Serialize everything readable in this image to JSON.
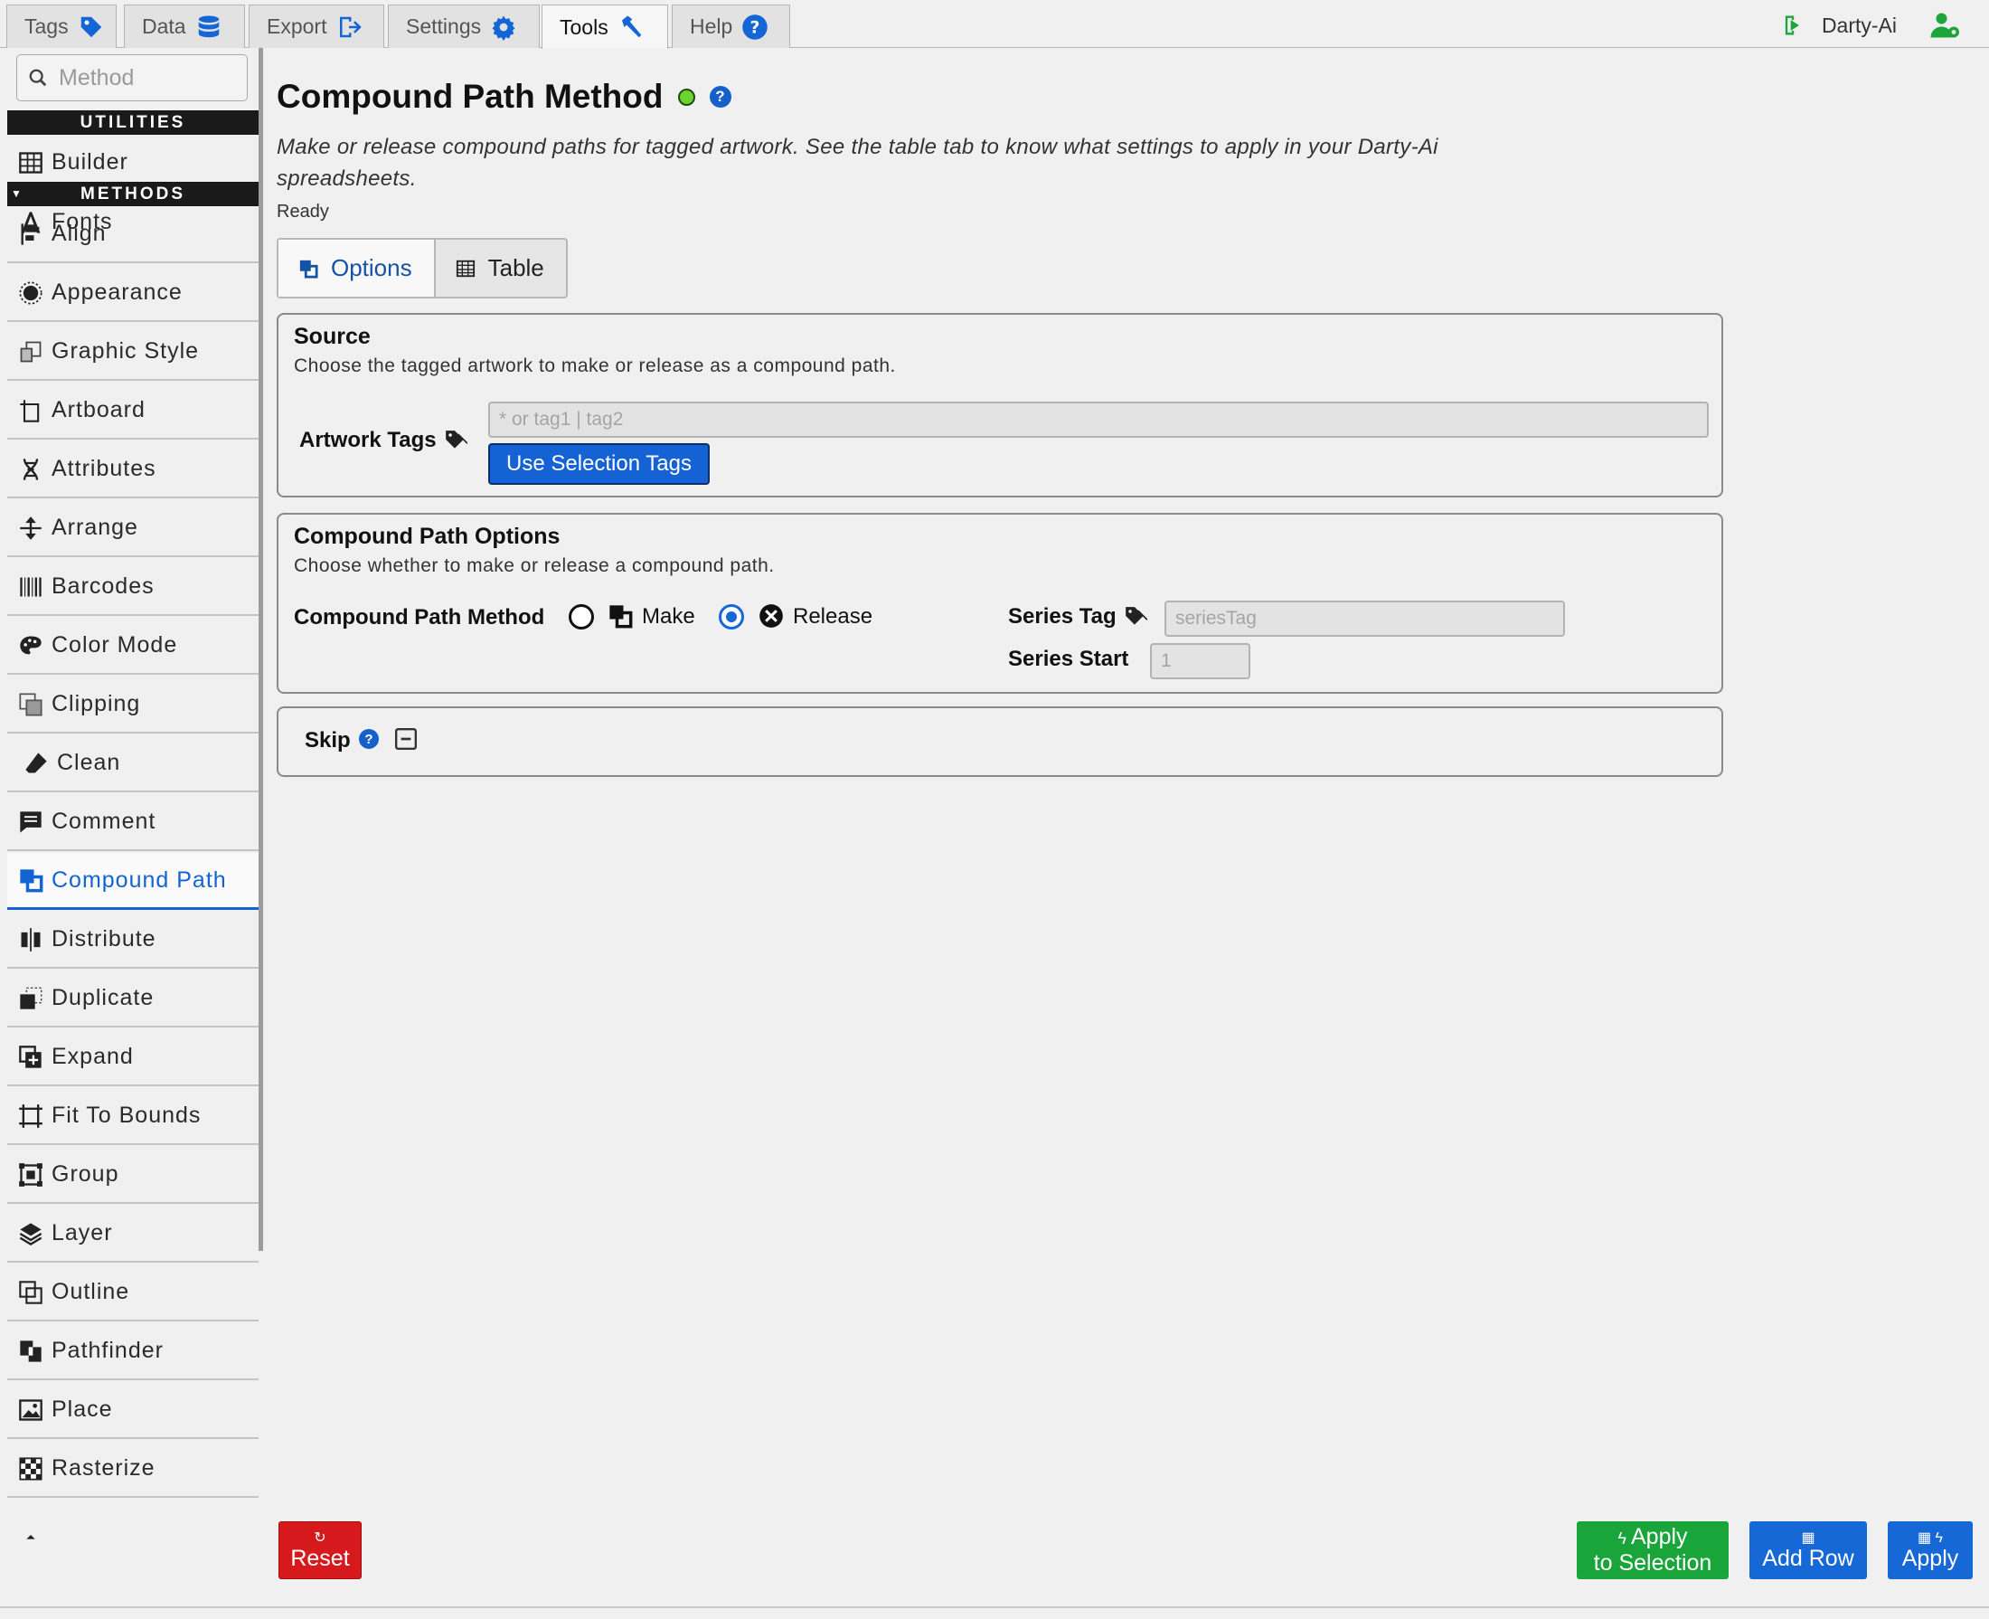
{
  "top_tabs": [
    {
      "label": "Tags",
      "icon": "tag-icon"
    },
    {
      "label": "Data",
      "icon": "database-icon"
    },
    {
      "label": "Export",
      "icon": "export-icon"
    },
    {
      "label": "Settings",
      "icon": "gear-icon"
    },
    {
      "label": "Tools",
      "icon": "hammer-icon"
    },
    {
      "label": "Help",
      "icon": "help-icon"
    }
  ],
  "active_top_tab": "Tools",
  "user": {
    "name": "Darty-Ai"
  },
  "sidebar": {
    "search_placeholder": "Method",
    "utilities_heading": "UTILITIES",
    "methods_heading": "METHODS",
    "utilities": [
      "Builder",
      "Fonts"
    ],
    "methods": [
      "Align",
      "Appearance",
      "Graphic Style",
      "Artboard",
      "Attributes",
      "Arrange",
      "Barcodes",
      "Color Mode",
      "Clipping",
      "Clean",
      "Comment",
      "Compound Path",
      "Distribute",
      "Duplicate",
      "Expand",
      "Fit To Bounds",
      "Group",
      "Layer",
      "Outline",
      "Pathfinder",
      "Place",
      "Rasterize"
    ],
    "selected": "Compound Path"
  },
  "main": {
    "title": "Compound Path Method",
    "help_glyph": "?",
    "description": "Make or release compound paths for tagged artwork. See the table tab to know what settings to apply in your Darty-Ai spreadsheets.",
    "status": "Ready",
    "tabs": [
      {
        "label": "Options"
      },
      {
        "label": "Table"
      }
    ],
    "active_tab": "Options"
  },
  "source_panel": {
    "title": "Source",
    "subtitle": "Choose the tagged artwork to make or release as a compound path.",
    "artwork_tags_label": "Artwork Tags",
    "artwork_tags_value": "",
    "artwork_tags_placeholder": "* or tag1 | tag2",
    "use_selection_button": "Use Selection Tags"
  },
  "options_panel": {
    "title": "Compound Path Options",
    "subtitle": "Choose whether to make or release a compound path.",
    "method_label": "Compound Path Method",
    "method_options": [
      "Make",
      "Release"
    ],
    "method_selected": "Release",
    "series_tag_label": "Series Tag",
    "series_tag_placeholder": "seriesTag",
    "series_start_label": "Series Start",
    "series_start_placeholder": "1"
  },
  "skip_panel": {
    "label": "Skip",
    "help_glyph": "?"
  },
  "footer": {
    "reset": "Reset",
    "apply_selection_line1": "Apply",
    "apply_selection_line2": "to Selection",
    "add_row": "Add Row",
    "apply": "Apply"
  },
  "colors": {
    "accent": "#1462d4",
    "selected_text": "#1463d2",
    "status_dot": "#6cd42e",
    "reset": "#d6191d",
    "apply_selection": "#1aa53a",
    "add_row": "#1568d6"
  }
}
